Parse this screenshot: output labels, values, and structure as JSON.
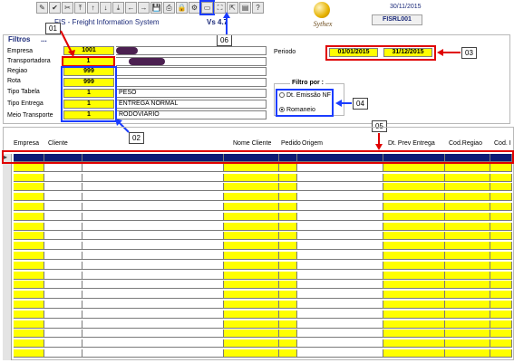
{
  "header": {
    "system_name": "FIS - Freight Information System",
    "version": "Vs 4.7",
    "logo_text": "Sythex",
    "date": "30/11/2015",
    "screen_code": "FISRL001"
  },
  "toolbar": {
    "icons": [
      "pencil-icon",
      "check-icon",
      "cut-icon",
      "first-icon",
      "up-icon",
      "down-icon",
      "last-icon",
      "left-icon",
      "right-icon",
      "save-icon",
      "print-icon",
      "lock-icon",
      "fish-icon",
      "window-icon",
      "filter-icon",
      "export-icon",
      "doc-icon",
      "help-icon"
    ],
    "glyphs": [
      "✎",
      "✔",
      "✂",
      "⤒",
      "↑",
      "↓",
      "⤓",
      "←",
      "→",
      "💾",
      "⎙",
      "🔒",
      "⚙",
      "▭",
      "⛶",
      "⇱",
      "▤",
      "?"
    ]
  },
  "filtros": {
    "title": "Filtros",
    "empresa_label": "Empresa",
    "empresa_value": "1001",
    "transportadora_label": "Transportadora",
    "transportadora_value": "1",
    "regiao_label": "Regiao",
    "regiao_value": "999",
    "rota_label": "Rota",
    "rota_value": "999",
    "tipo_tabela_label": "Tipo Tabela",
    "tipo_tabela_value": "1",
    "tipo_tabela_desc": "PESO",
    "tipo_entrega_label": "Tipo Entrega",
    "tipo_entrega_value": "1",
    "tipo_entrega_desc": "ENTREGA NORMAL",
    "meio_transporte_label": "Meio Transporte",
    "meio_transporte_value": "1",
    "meio_transporte_desc": "RODOVIARIO",
    "periodo_label": "Periodo",
    "periodo_start": "01/01/2015",
    "periodo_end": "31/12/2015",
    "filtro_por_title": "Filtro por :",
    "option_emissao": "Dt. Emissão NF",
    "option_romaneio": "Romaneio",
    "selected_option": "Romaneio"
  },
  "callouts": {
    "c01": "01",
    "c02": "02",
    "c03": "03",
    "c04": "04",
    "c05": "05",
    "c06": "06"
  },
  "grid": {
    "columns": [
      "Empresa",
      "Cliente",
      "Nome Cliente",
      "Pedido",
      "Origem",
      "Dt. Prev Entrega",
      "Cod.Regiao",
      "Cod. I"
    ],
    "row_count": 21
  },
  "colors": {
    "field_yellow": "#ffff00",
    "header_navy": "#0c1a75",
    "annotation_red": "#e00000",
    "annotation_blue": "#1a3cff"
  }
}
